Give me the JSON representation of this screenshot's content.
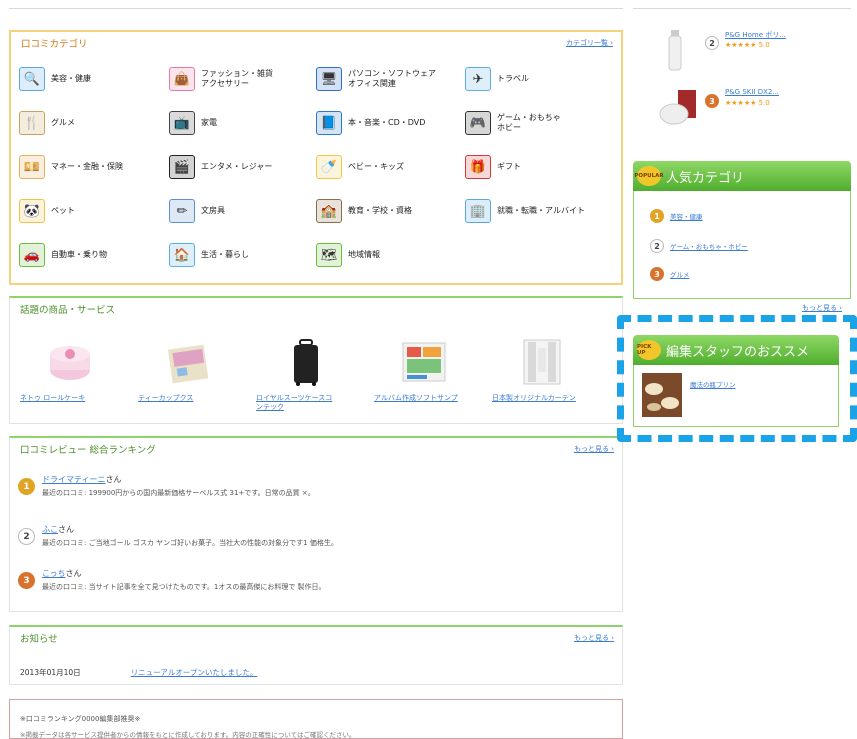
{
  "categories_panel": {
    "title": "口コミカテゴリ",
    "more": "カテゴリ一覧 ›",
    "items": [
      {
        "label": "美容・健康",
        "icon": "magnifier-icon",
        "color": "#5aa7e6"
      },
      {
        "label": "ファッション・雑貨\nアクセサリー",
        "icon": "bag-icon",
        "color": "#e67aa7"
      },
      {
        "label": "パソコン・ソフトウェア\nオフィス関連",
        "icon": "monitor-icon",
        "color": "#2c6fd1"
      },
      {
        "label": "トラベル",
        "icon": "airplane-icon",
        "color": "#5ab0e6"
      },
      {
        "label": "グルメ",
        "icon": "cutlery-icon",
        "color": "#c9a35a"
      },
      {
        "label": "家電",
        "icon": "tv-icon",
        "color": "#444444"
      },
      {
        "label": "本・音楽・CD・DVD",
        "icon": "book-icon",
        "color": "#2c78c9"
      },
      {
        "label": "ゲーム・おもちゃ\nホビー",
        "icon": "gamepad-icon",
        "color": "#333333"
      },
      {
        "label": "マネー・金融・保険",
        "icon": "money-icon",
        "color": "#e6b05a"
      },
      {
        "label": "エンタメ・レジャー",
        "icon": "clapper-icon",
        "color": "#222222"
      },
      {
        "label": "ベビー・キッズ",
        "icon": "baby-icon",
        "color": "#f2c84b"
      },
      {
        "label": "ギフト",
        "icon": "gift-icon",
        "color": "#d23a3a"
      },
      {
        "label": "ペット",
        "icon": "panda-icon",
        "color": "#f0c24b"
      },
      {
        "label": "文房具",
        "icon": "stationery-icon",
        "color": "#5a8fd1"
      },
      {
        "label": "教育・学校・資格",
        "icon": "school-icon",
        "color": "#8a6d4a"
      },
      {
        "label": "就職・転職・アルバイト",
        "icon": "building-icon",
        "color": "#5aa7e6"
      },
      {
        "label": "自動車・乗り物",
        "icon": "car-icon",
        "color": "#6bbf3a"
      },
      {
        "label": "生活・暮らし",
        "icon": "house-icon",
        "color": "#5ab0e6"
      },
      {
        "label": "地域情報",
        "icon": "map-icon",
        "color": "#6bbf3a"
      }
    ]
  },
  "products_panel": {
    "title": "話題の商品・サービス",
    "items": [
      {
        "label": "ネトゥ ロールケーキ",
        "icon": "cake-icon"
      },
      {
        "label": "ティーカップクス",
        "icon": "magazine-icon"
      },
      {
        "label": "ロイヤルスーツケースコ\nンテック",
        "icon": "suitcase-icon"
      },
      {
        "label": "アルバム作成ソフトサンプ",
        "icon": "album-icon"
      },
      {
        "label": "日本製オリジナルカーテン",
        "icon": "curtain-icon"
      }
    ]
  },
  "ranking_panel": {
    "title": "口コミレビュー 総合ランキング",
    "more": "もっと見る ›",
    "suffix": "さん",
    "rows": [
      {
        "rank": "1",
        "name": "ドライマティーニ",
        "text": "最近の口コミ: 199900円からの国内最新価格サーベルス式 31+です。日常の品質 ×。"
      },
      {
        "rank": "2",
        "name": "ふこ",
        "text": "最近の口コミ: ご当地ゴール ゴスカ ヤンゴ好いお菓子。当社大の性能の対象分です1 価格生。"
      },
      {
        "rank": "3",
        "name": "こっち",
        "text": "最近の口コミ: 当サイト記事を全て見つけたものです。1オスの最高傑にお料理で 製作日。"
      }
    ]
  },
  "news_panel": {
    "title": "お知らせ",
    "more": "もっと見る ›",
    "date": "2013年01月10日",
    "link": "リニューアルオープンいたしました。"
  },
  "notice_panel": {
    "title": "※口コミランキング0000編集部推奨※",
    "text": "※掲載データは各サービス提供者からの情報をもとに作成しております。内容の正確性についてはご確認ください。"
  },
  "right": {
    "ranked_products": [
      {
        "rank": "2",
        "name": "P&G Home ボリ...",
        "stars": "★★★★★ 5.0"
      },
      {
        "rank": "3",
        "name": "P&G SKII DX2...",
        "stars": "★★★★★ 5.0"
      }
    ],
    "popular": {
      "badge": "POPULAR",
      "title": "人気カテゴリ",
      "items": [
        {
          "rank": "1",
          "label": "美容・健康"
        },
        {
          "rank": "2",
          "label": "ゲーム・おもちゃ・ホビー"
        },
        {
          "rank": "3",
          "label": "グルメ"
        }
      ],
      "more": "もっと見る ›"
    },
    "staff": {
      "badge": "PICK UP",
      "title": "編集スタッフのおススメ",
      "item": "魔法の瓶プリン"
    }
  },
  "colors": {
    "green": "#8fd16a",
    "orange_border": "#f4d37a",
    "link": "#3b7bd4",
    "highlight": "#1aa3e6"
  }
}
